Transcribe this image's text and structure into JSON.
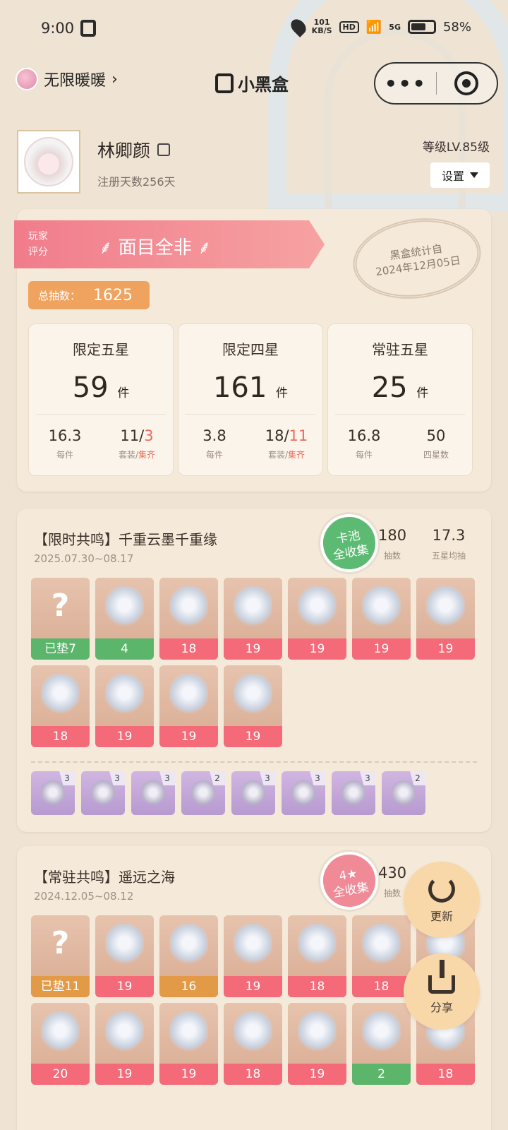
{
  "status": {
    "time": "9:00",
    "speed_top": "101",
    "speed_unit": "KB/S",
    "hd": "HD",
    "network": "5G",
    "battery": "58%"
  },
  "nav": {
    "back_label": "无限暖暖",
    "back_chevron": "›",
    "title": "小黑盒",
    "more": "•••"
  },
  "profile": {
    "name": "林卿颜",
    "days": "注册天数256天",
    "level": "等级LV.85级",
    "settings": "设置"
  },
  "rating": {
    "label_1": "玩家",
    "label_2": "评分",
    "title": "面目全非",
    "stamp_line1": "黑盒统计自",
    "stamp_line2": "2024年12月05日",
    "total_label": "总抽数：",
    "total_value": "1625"
  },
  "stats": [
    {
      "title": "限定五星",
      "count": "59",
      "unit": "件",
      "v1": "16.3",
      "c1": "每件",
      "v2a": "11/",
      "v2b": "3",
      "c2a": "套装/",
      "c2b": "集齐"
    },
    {
      "title": "限定四星",
      "count": "161",
      "unit": "件",
      "v1": "3.8",
      "c1": "每件",
      "v2a": "18/",
      "v2b": "11",
      "c2a": "套装/",
      "c2b": "集齐"
    },
    {
      "title": "常驻五星",
      "count": "25",
      "unit": "件",
      "v1": "16.8",
      "c1": "每件",
      "v2a": "50",
      "v2b": "",
      "c2a": "四星数",
      "c2b": ""
    }
  ],
  "pool1": {
    "title": "【限时共鸣】千重云墨千重缘",
    "date": "2025.07.30~08.17",
    "badge_1": "卡池",
    "badge_2": "全收集",
    "stat1_value": "180",
    "stat1_label": "抽数",
    "stat2_value": "17.3",
    "stat2_label": "五星均抽",
    "items": [
      {
        "label": "已垫7",
        "type": "green",
        "unknown": "?"
      },
      {
        "label": "4",
        "type": "green"
      },
      {
        "label": "18",
        "type": "red"
      },
      {
        "label": "19",
        "type": "red"
      },
      {
        "label": "19",
        "type": "red"
      },
      {
        "label": "19",
        "type": "red"
      },
      {
        "label": "19",
        "type": "red"
      },
      {
        "label": "18",
        "type": "red"
      },
      {
        "label": "19",
        "type": "red"
      },
      {
        "label": "19",
        "type": "red"
      },
      {
        "label": "19",
        "type": "red"
      }
    ],
    "small": [
      "3",
      "3",
      "3",
      "2",
      "3",
      "3",
      "3",
      "2"
    ]
  },
  "pool2": {
    "title": "【常驻共鸣】遥远之海",
    "date": "2024.12.05~08.12",
    "badge_1": "4★",
    "badge_2": "全收集",
    "stat1_value": "430",
    "stat1_label": "抽数",
    "items": [
      {
        "label": "已垫11",
        "type": "orange",
        "unknown": "?"
      },
      {
        "label": "19",
        "type": "red"
      },
      {
        "label": "16",
        "type": "orange"
      },
      {
        "label": "19",
        "type": "red"
      },
      {
        "label": "18",
        "type": "red"
      },
      {
        "label": "18",
        "type": "red"
      },
      {
        "label": "",
        "type": "red"
      },
      {
        "label": "20",
        "type": "red"
      },
      {
        "label": "19",
        "type": "red"
      },
      {
        "label": "19",
        "type": "red"
      },
      {
        "label": "18",
        "type": "red"
      },
      {
        "label": "19",
        "type": "red"
      },
      {
        "label": "2",
        "type": "green"
      },
      {
        "label": "18",
        "type": "red"
      }
    ]
  },
  "fab": {
    "refresh": "更新",
    "share": "分享"
  },
  "colors": {
    "red_label": "#f46a78",
    "green_label": "#5bb56a",
    "orange_label": "#e39a47",
    "ribbon": "#f17c8b"
  }
}
